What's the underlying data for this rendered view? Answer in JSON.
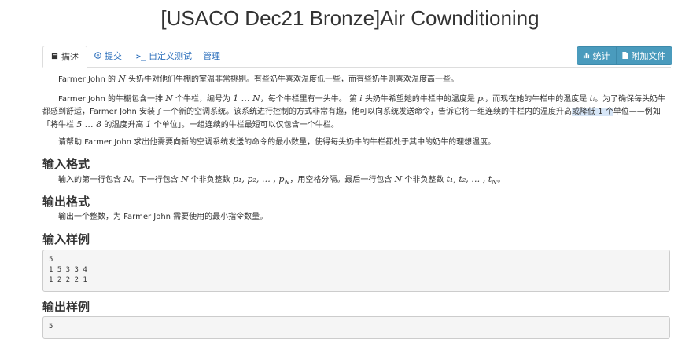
{
  "title": "[USACO Dec21 Bronze]Air Cownditioning",
  "tabs": [
    {
      "label": "描述",
      "icon": "book-icon"
    },
    {
      "label": "提交",
      "icon": "upload-icon"
    },
    {
      "label": "自定义测试",
      "icon": "terminal-icon"
    },
    {
      "label": "管理",
      "icon": ""
    }
  ],
  "buttons": {
    "stats": "统计",
    "attachments": "附加文件"
  },
  "description": {
    "p1": {
      "a": "Farmer John 的 ",
      "b": "N",
      "c": " 头奶牛对他们牛棚的室温非常挑剔。有些奶牛喜欢温度低一些，而有些奶牛则喜欢温度高一些。"
    },
    "p2": {
      "a": "Farmer John 的牛棚包含一排 ",
      "b": "N",
      "c": " 个牛栏，编号为 ",
      "d": "1 … N",
      "e": "，每个牛栏里有一头牛。 第 ",
      "f": "i",
      "g": " 头奶牛希望她的牛栏中的温度是 ",
      "h": "pᵢ",
      "i": "，而现在她的牛栏中的温度是 ",
      "j": "tᵢ",
      "k": "。为了确保每头奶牛都感到舒适，Farmer John 安装了一个新的空调系统。该系统进行控制的方式非常有趣，他可以向系统发送命令，告诉它将一组连续的牛栏内的温度升高",
      "l": "或降低 1 个",
      "m": "单位——例如「将牛栏 ",
      "n": "5 … 8",
      "o": " 的温度升高 ",
      "p": "1",
      "q": " 个单位」。一组连续的牛栏最短可以仅包含一个牛栏。"
    },
    "p3": "请帮助 Farmer John 求出他需要向新的空调系统发送的命令的最小数量，使得每头奶牛的牛栏都处于其中的奶牛的理想温度。"
  },
  "input_format": {
    "heading": "输入格式",
    "a": "输入的第一行包含 ",
    "b": "N",
    "c": "。下一行包含 ",
    "d": "N",
    "e": " 个非负整数 ",
    "f": "p₁, p₂, … , p",
    "g": "N",
    "h": "，用空格分隔。最后一行包含 ",
    "i": "N",
    "j": " 个非负整数 ",
    "k": "t₁, t₂, … , t",
    "l": "N",
    "m": "。"
  },
  "output_format": {
    "heading": "输出格式",
    "text": "输出一个整数，为 Farmer John 需要使用的最小指令数量。"
  },
  "sample_input": {
    "heading": "输入样例",
    "lines": [
      "5",
      "1 5 3 3 4",
      "1 2 2 2 1"
    ]
  },
  "sample_output": {
    "heading": "输出样例",
    "lines": [
      "5"
    ]
  }
}
